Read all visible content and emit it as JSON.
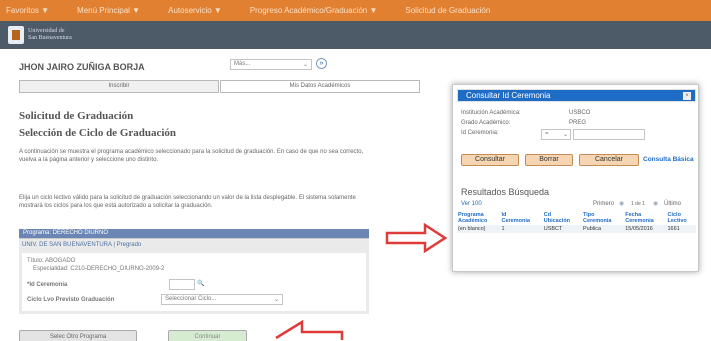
{
  "topnav": [
    "Favoritos ▼",
    "Menú Principal ▼",
    "Autoservicio ▼",
    "Progreso Académico/Graduación ▼",
    "Solicitud de Graduación"
  ],
  "logo": {
    "line1": "Universidad de",
    "line2": "San Buenaventura"
  },
  "student_name": "JHON JAIRO ZUÑIGA BORJA",
  "more_select": "Más...",
  "tabs": [
    "Inscribir",
    "Mis Datos Académicos"
  ],
  "page_title": "Solicitud de Graduación",
  "page_subtitle": "Selección de Ciclo de Graduación",
  "para1": "A continuación se muestra el programa académico seleccionado para la solicitud de graduación. En caso de que no sea correcto, vuelva a la página anterior y seleccione uno distinto.",
  "para2": "Elija un ciclo lectivo válido para la solicitud de graduación seleccionando un valor de la lista desplegable. El sistema solamente mostrará los ciclos para los que está autorizado a solicitar la graduación.",
  "program_band": "Programa: DERECHO DIURNO",
  "program_univ": "UNIV. DE SAN BUENAVENTURA | Pregrado",
  "title_label": "Título: ABOGADO",
  "specialty_label": "Especialidad: C210-DERECHO_DIURNO-2009-2",
  "ceremony_label": "*Id Ceremonia",
  "cycle_label": "Ciclo Lvo Previsto Graduación",
  "cycle_select": "Seleccionar Ciclo...",
  "btn_other_program": "Selec Otro Programa",
  "btn_continue": "Continuar",
  "modal": {
    "title": "Consultar Id Ceremonia",
    "fields": [
      {
        "label": "Institución Académica:",
        "value": "USBCO"
      },
      {
        "label": "Grado Académico:",
        "value": "PREG"
      },
      {
        "label": "Id Ceremonia:",
        "value": "="
      }
    ],
    "buttons": [
      "Consultar",
      "Borrar",
      "Cancelar"
    ],
    "basic_link": "Consulta Básica",
    "results_title": "Resultados Búsqueda",
    "view_all": "Ver 100",
    "pager_first": "Primero",
    "pager_range": "1 de 1",
    "pager_last": "Último",
    "columns": [
      [
        "Programa",
        "Académico"
      ],
      [
        "Id",
        "Ceremonia"
      ],
      [
        "Cd",
        "Ubicación"
      ],
      [
        "Tipo",
        "Ceremonia"
      ],
      [
        "Fecha",
        "Ceremonia"
      ],
      [
        "Ciclo",
        "Lectivo"
      ]
    ],
    "rows": [
      [
        "(en blanco)",
        "1",
        "USBCT",
        "Publica",
        "15/05/2016",
        "1661"
      ]
    ]
  },
  "colors": {
    "nav": "#e08030",
    "header": "#4d5a68",
    "modal_header": "#1f6cc6",
    "arrow": "#e03b3b"
  }
}
